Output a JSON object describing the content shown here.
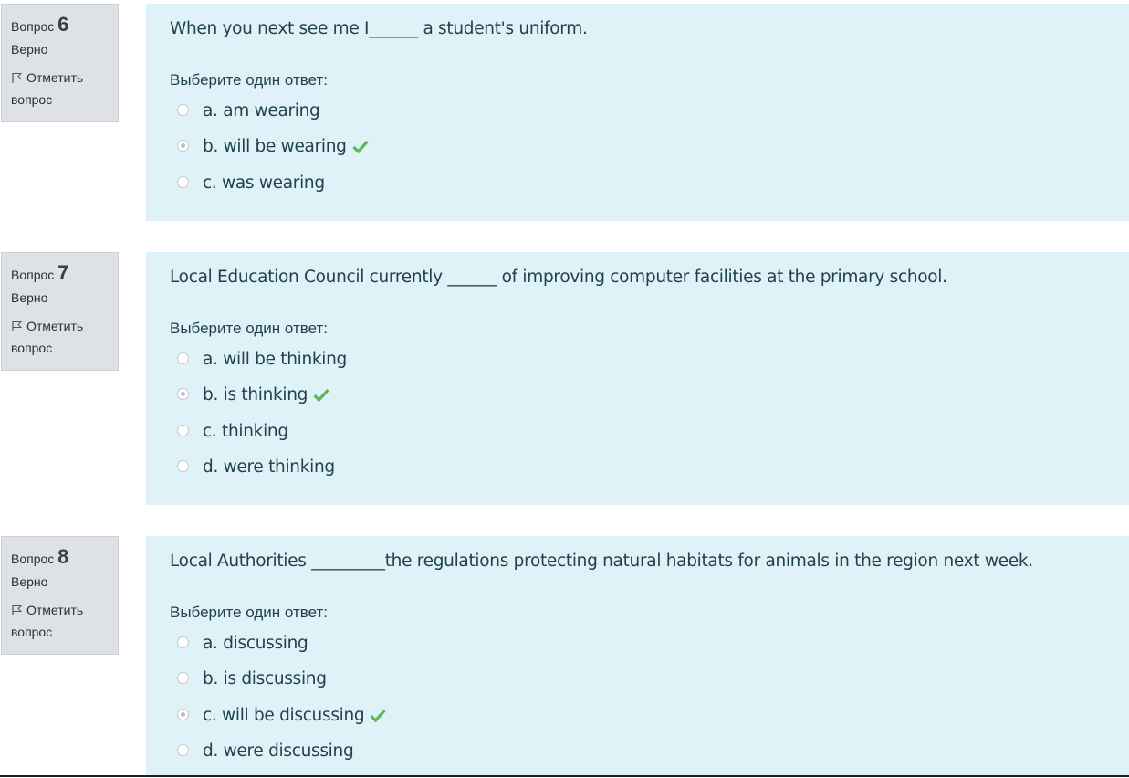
{
  "labels": {
    "question": "Вопрос",
    "correct": "Верно",
    "flag": "Отметить вопрос",
    "choose": "Выберите один ответ:"
  },
  "questions": [
    {
      "number": "6",
      "text": "When you next see me I______ a student's uniform.",
      "options": [
        {
          "label": "a. am wearing",
          "selected": false,
          "correct": false
        },
        {
          "label": "b. will be wearing",
          "selected": true,
          "correct": true
        },
        {
          "label": "c. was wearing",
          "selected": false,
          "correct": false
        }
      ]
    },
    {
      "number": "7",
      "text": "Local Education Council  currently ______ of  improving computer facilities at the primary school.",
      "options": [
        {
          "label": "a. will be thinking",
          "selected": false,
          "correct": false
        },
        {
          "label": "b. is thinking",
          "selected": true,
          "correct": true
        },
        {
          "label": "c. thinking",
          "selected": false,
          "correct": false
        },
        {
          "label": "d. were thinking",
          "selected": false,
          "correct": false
        }
      ]
    },
    {
      "number": "8",
      "text": "Local Authorities  _________the regulations protecting natural habitats for animals in the region next week.",
      "options": [
        {
          "label": "a. discussing",
          "selected": false,
          "correct": false
        },
        {
          "label": "b. is discussing",
          "selected": false,
          "correct": false
        },
        {
          "label": "c. will be discussing",
          "selected": true,
          "correct": true
        },
        {
          "label": "d. were discussing",
          "selected": false,
          "correct": false
        }
      ]
    }
  ],
  "colors": {
    "check": "#5cb85c",
    "content_bg": "#def2f8",
    "info_bg": "#dee2e6"
  }
}
